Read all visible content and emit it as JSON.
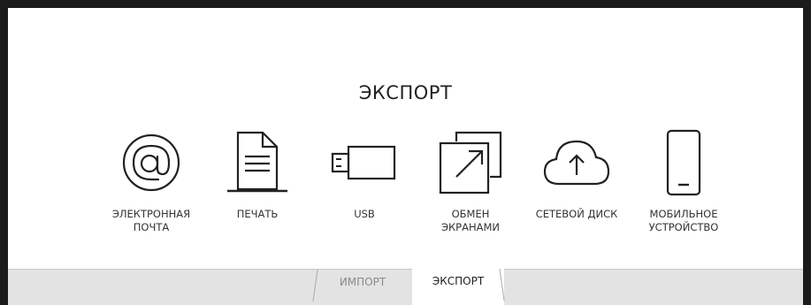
{
  "title": "ЭКСПОРТ",
  "items": [
    {
      "label": "ЭЛЕКТРОННАЯ\nПОЧТА",
      "icon": "at-icon"
    },
    {
      "label": "ПЕЧАТЬ",
      "icon": "document-icon"
    },
    {
      "label": "USB",
      "icon": "usb-icon"
    },
    {
      "label": "ОБМЕН\nЭКРАНАМИ",
      "icon": "screen-share-icon"
    },
    {
      "label": "СЕТЕВОЙ ДИСК",
      "icon": "cloud-upload-icon"
    },
    {
      "label": "МОБИЛЬНОЕ\nУСТРОЙСТВО",
      "icon": "mobile-phone-icon"
    }
  ],
  "tabs": [
    {
      "label": "ИМПОРТ",
      "active": false
    },
    {
      "label": "ЭКСПОРТ",
      "active": true
    }
  ],
  "colors": {
    "frame": "#1b1b1b",
    "panel": "#ffffff",
    "tabbar": "#e3e3e3",
    "text": "#222222",
    "tab_inactive_text": "#8a8a8a"
  }
}
